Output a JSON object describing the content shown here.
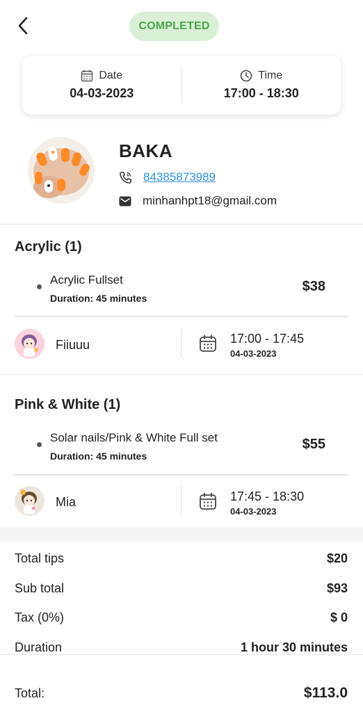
{
  "header": {
    "back_icon": "chevron-left-icon",
    "status": "COMPLETED",
    "status_bg": "#d9f0d6",
    "status_color": "#4aa84a"
  },
  "schedule": {
    "date_label": "Date",
    "date_value": "04-03-2023",
    "time_label": "Time",
    "time_value": "17:00 - 18:30"
  },
  "customer": {
    "name": "BAKA",
    "phone": "84385873989",
    "email": "minhanhpt18@gmail.com",
    "link_color": "#2f8fe0"
  },
  "services": [
    {
      "category": "Acrylic (1)",
      "item_name": "Acrylic Fullset",
      "item_duration": "Duration: 45 minutes",
      "item_price": "$38",
      "staff_name": "Fiiuuu",
      "slot_time": "17:00 - 17:45",
      "slot_date": "04-03-2023"
    },
    {
      "category": "Pink & White (1)",
      "item_name": "Solar nails/Pink & White Full set",
      "item_duration": "Duration: 45 minutes",
      "item_price": "$55",
      "staff_name": "Mia",
      "slot_time": "17:45 - 18:30",
      "slot_date": "04-03-2023"
    }
  ],
  "summary": {
    "tips_label": "Total tips",
    "tips_value": "$20",
    "subtotal_label": "Sub total",
    "subtotal_value": "$93",
    "tax_label": "Tax (0%)",
    "tax_value": "$ 0",
    "duration_label": "Duration",
    "duration_value": "1 hour 30 minutes",
    "total_label": "Total:",
    "total_value": "$113.0"
  }
}
